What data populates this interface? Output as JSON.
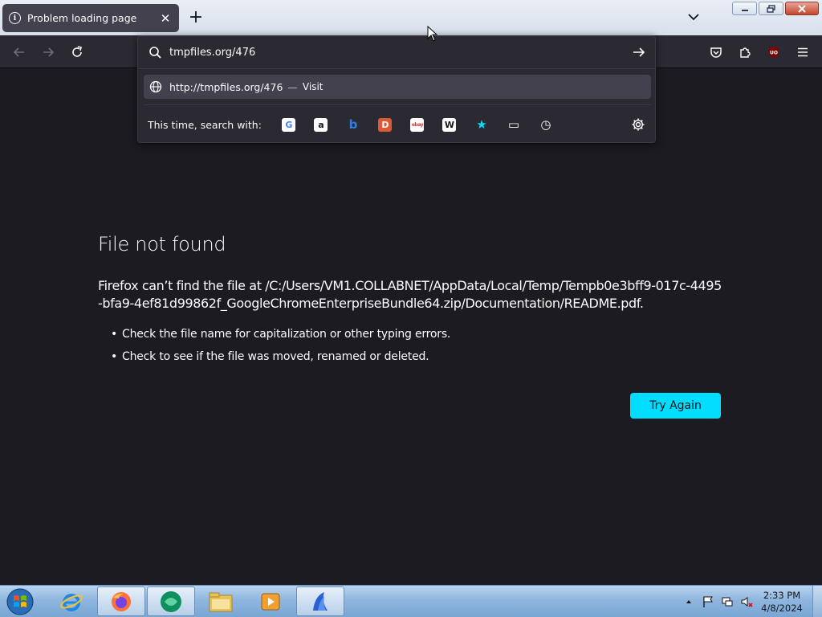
{
  "tab": {
    "title": "Problem loading page",
    "close_glyph": "✕",
    "newtab_glyph": "+"
  },
  "urlbar": {
    "value": "tmpfiles.org/476",
    "result_url": "http://tmpfiles.org/476",
    "result_dash": "—",
    "result_action": "Visit",
    "search_with_label": "This time, search with:",
    "engines": [
      {
        "name": "google-icon",
        "glyph": "G",
        "bg": "#ffffff",
        "fg": "#4285f4"
      },
      {
        "name": "amazon-icon",
        "glyph": "a",
        "bg": "#ffffff",
        "fg": "#15141a"
      },
      {
        "name": "bing-icon",
        "glyph": "b",
        "bg": "transparent",
        "fg": "#2f7de1"
      },
      {
        "name": "duckduckgo-icon",
        "glyph": "D",
        "bg": "#de5833",
        "fg": "#ffffff"
      },
      {
        "name": "ebay-icon",
        "glyph": "ebay",
        "bg": "#ffffff",
        "fg": "#e53238"
      },
      {
        "name": "wikipedia-icon",
        "glyph": "W",
        "bg": "#ffffff",
        "fg": "#15141a"
      },
      {
        "name": "bookmarks-star-icon",
        "glyph": "★",
        "bg": "transparent",
        "fg": "#00ddff"
      },
      {
        "name": "tabs-icon",
        "glyph": "▭",
        "bg": "transparent",
        "fg": "#fbfbfe"
      },
      {
        "name": "history-icon",
        "glyph": "◷",
        "bg": "transparent",
        "fg": "#fbfbfe"
      }
    ]
  },
  "error": {
    "title": "File not found",
    "description": "Firefox can’t find the file at /C:/Users/VM1.COLLABNET/AppData/Local/Temp/Tempb0e3bff9-017c-4495-bfa9-4ef81d99862f_GoogleChromeEnterpriseBundle64.zip/Documentation/README.pdf.",
    "tips": [
      "Check the file name for capitalization or other typing errors.",
      "Check to see if the file was moved, renamed or deleted."
    ],
    "button": "Try Again"
  },
  "taskbar": {
    "time": "2:33 PM",
    "date": "4/8/2024"
  },
  "colors": {
    "page_bg": "#1c1b22",
    "toolbar_bg": "#2b2a33",
    "accent": "#00ddff"
  }
}
